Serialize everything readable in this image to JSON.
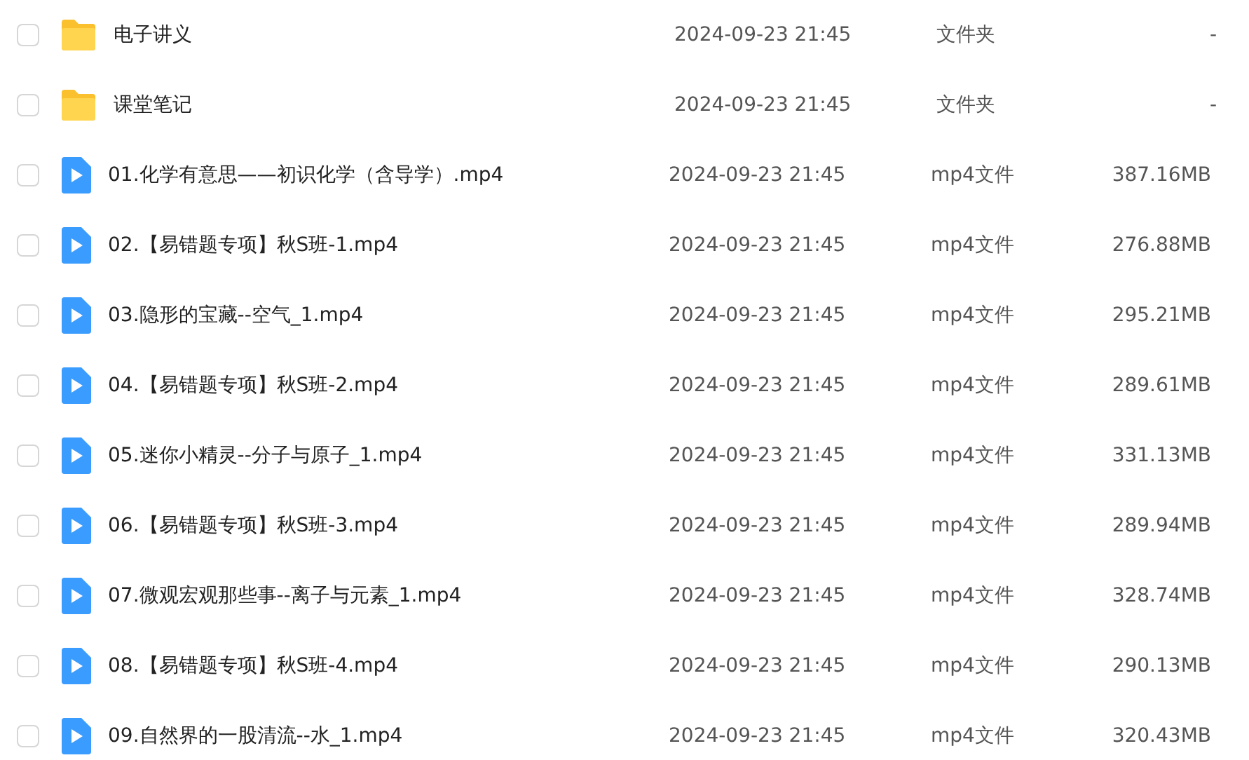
{
  "files": [
    {
      "kind": "folder",
      "checked": false,
      "name": "电子讲义",
      "modified": "2024-09-23 21:45",
      "type": "文件夹",
      "size": "-"
    },
    {
      "kind": "folder",
      "checked": false,
      "name": "课堂笔记",
      "modified": "2024-09-23 21:45",
      "type": "文件夹",
      "size": "-"
    },
    {
      "kind": "video",
      "checked": false,
      "name": "01.化学有意思——初识化学（含导学）.mp4",
      "modified": "2024-09-23 21:45",
      "type": "mp4文件",
      "size": "387.16MB"
    },
    {
      "kind": "video",
      "checked": false,
      "name": "02.【易错题专项】秋S班-1.mp4",
      "modified": "2024-09-23 21:45",
      "type": "mp4文件",
      "size": "276.88MB"
    },
    {
      "kind": "video",
      "checked": false,
      "name": "03.隐形的宝藏--空气_1.mp4",
      "modified": "2024-09-23 21:45",
      "type": "mp4文件",
      "size": "295.21MB"
    },
    {
      "kind": "video",
      "checked": false,
      "name": "04.【易错题专项】秋S班-2.mp4",
      "modified": "2024-09-23 21:45",
      "type": "mp4文件",
      "size": "289.61MB"
    },
    {
      "kind": "video",
      "checked": false,
      "name": "05.迷你小精灵--分子与原子_1.mp4",
      "modified": "2024-09-23 21:45",
      "type": "mp4文件",
      "size": "331.13MB"
    },
    {
      "kind": "video",
      "checked": false,
      "name": "06.【易错题专项】秋S班-3.mp4",
      "modified": "2024-09-23 21:45",
      "type": "mp4文件",
      "size": "289.94MB"
    },
    {
      "kind": "video",
      "checked": false,
      "name": "07.微观宏观那些事--离子与元素_1.mp4",
      "modified": "2024-09-23 21:45",
      "type": "mp4文件",
      "size": "328.74MB"
    },
    {
      "kind": "video",
      "checked": false,
      "name": "08.【易错题专项】秋S班-4.mp4",
      "modified": "2024-09-23 21:45",
      "type": "mp4文件",
      "size": "290.13MB"
    },
    {
      "kind": "video",
      "checked": false,
      "name": "09.自然界的一股清流--水_1.mp4",
      "modified": "2024-09-23 21:45",
      "type": "mp4文件",
      "size": "320.43MB"
    }
  ]
}
